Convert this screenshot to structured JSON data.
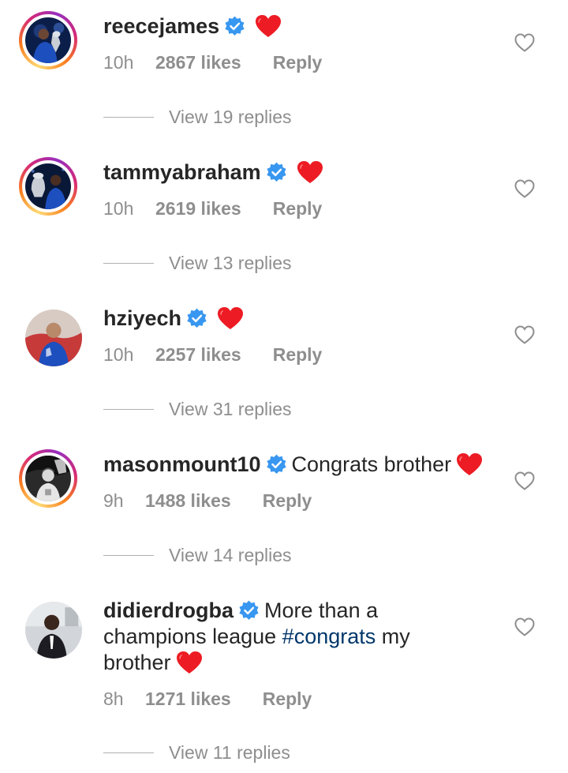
{
  "colors": {
    "verified_blue": "#3897f0",
    "heart_red": "#ed1c24",
    "hashtag_blue": "#00376b",
    "meta_gray": "#8e8e8e"
  },
  "comments": [
    {
      "username": "reecejames",
      "verified": true,
      "text": "",
      "trailing_heart": true,
      "time": "10h",
      "likes": "2867 likes",
      "reply_label": "Reply",
      "view_replies": "View 19 replies",
      "avatar": "story-ring"
    },
    {
      "username": "tammyabraham",
      "verified": true,
      "text": "",
      "trailing_heart": true,
      "time": "10h",
      "likes": "2619 likes",
      "reply_label": "Reply",
      "view_replies": "View 13 replies",
      "avatar": "story-ring"
    },
    {
      "username": "hziyech",
      "verified": true,
      "text": "",
      "trailing_heart": true,
      "time": "10h",
      "likes": "2257 likes",
      "reply_label": "Reply",
      "view_replies": "View 31 replies",
      "avatar": "plain"
    },
    {
      "username": "masonmount10",
      "verified": true,
      "text": "Congrats brother",
      "trailing_heart": true,
      "time": "9h",
      "likes": "1488 likes",
      "reply_label": "Reply",
      "view_replies": "View 14 replies",
      "avatar": "story-ring"
    },
    {
      "username": "didierdrogba",
      "verified": true,
      "text_before_hashtag": "More than a champions league",
      "hashtag": "#congrats",
      "text_after_hashtag": "my brother",
      "trailing_heart": true,
      "time": "8h",
      "likes": "1271 likes",
      "reply_label": "Reply",
      "view_replies": "View 11 replies",
      "avatar": "plain"
    }
  ],
  "icons": {
    "verified": "verified-badge-icon",
    "heart": "red-heart-emoji",
    "like": "heart-outline-icon"
  }
}
